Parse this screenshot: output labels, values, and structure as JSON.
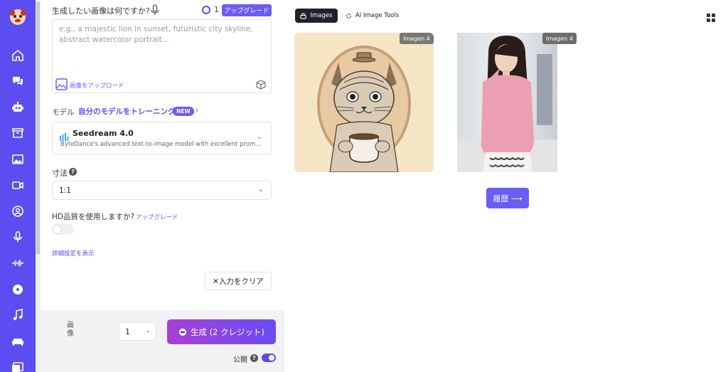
{
  "prompt": {
    "label": "生成したい画像は何ですか?",
    "credits": "1",
    "upgrade_label": "アップグレード",
    "placeholder": "e.g., a majestic lion in sunset, futuristic city skyline, abstract watercolor portrait...",
    "upload_label": "画像をアップロード"
  },
  "model": {
    "label": "モデル",
    "train_link": "自分のモデルをトレーニング",
    "new_badge": "NEW",
    "name": "Seedream 4.0",
    "description": "ByteDance's advanced text-to-image model with excellent prom..."
  },
  "size": {
    "label": "寸法",
    "value": "1:1"
  },
  "hd": {
    "label": "HD品質を使用しますか?",
    "upgrade_label": "アップグレード",
    "enabled": false
  },
  "advanced_link": "詳細設定を表示",
  "clear_button": "✕入力をクリア",
  "generate": {
    "images_label": "画像",
    "count": "1",
    "button_label": "生成 (2 クレジット)",
    "public_label": "公開",
    "public_enabled": true
  },
  "tabs": {
    "images": "Images",
    "ai_tools": "AI Image Tools"
  },
  "results": [
    {
      "tag": "Imagen 4"
    },
    {
      "tag": "Imagen 4"
    }
  ],
  "history_button": "履歴 ⟶",
  "colors": {
    "sidebar": "#5b4df0",
    "accent": "#6b5cf5",
    "generate_start": "#a93fd6",
    "generate_end": "#6a4cf2"
  },
  "sidebar_icons": [
    "logo-icon",
    "home-icon",
    "chat-icon",
    "robot-icon",
    "box-icon",
    "image-icon",
    "video-icon",
    "user-circle-icon",
    "mic-icon",
    "waveform-icon",
    "disc-icon",
    "music-icon",
    "sofa-icon",
    "gallery-icon"
  ]
}
